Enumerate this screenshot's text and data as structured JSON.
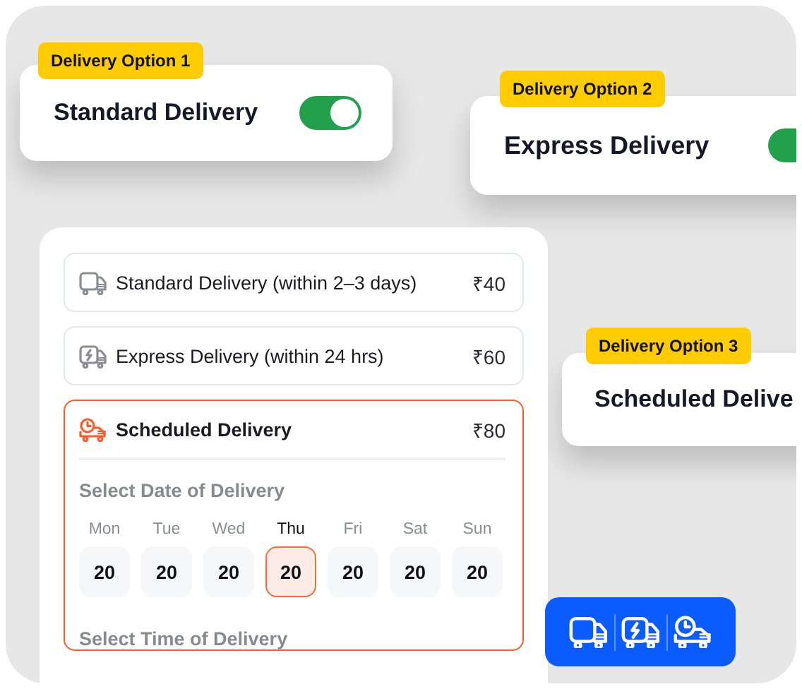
{
  "option_cards": [
    {
      "badge": "Delivery Option 1",
      "title": "Standard Delivery",
      "toggle_on": true
    },
    {
      "badge": "Delivery Option 2",
      "title": "Express Delivery",
      "toggle_on": true
    },
    {
      "badge": "Delivery Option 3",
      "title": "Scheduled Delive"
    }
  ],
  "delivery_panel": {
    "options": [
      {
        "kind": "standard",
        "label": "Standard Delivery (within 2–3 days)",
        "price": "₹40",
        "selected": false
      },
      {
        "kind": "express",
        "label": "Express Delivery (within 24 hrs)",
        "price": "₹60",
        "selected": false
      },
      {
        "kind": "scheduled",
        "label": "Scheduled Delivery",
        "price": "₹80",
        "selected": true
      }
    ],
    "date_heading": "Select Date of Delivery",
    "days": [
      {
        "day": "Mon",
        "date": "20",
        "selected": false
      },
      {
        "day": "Tue",
        "date": "20",
        "selected": false
      },
      {
        "day": "Wed",
        "date": "20",
        "selected": false
      },
      {
        "day": "Thu",
        "date": "20",
        "selected": true
      },
      {
        "day": "Fri",
        "date": "20",
        "selected": false
      },
      {
        "day": "Sat",
        "date": "20",
        "selected": false
      },
      {
        "day": "Sun",
        "date": "20",
        "selected": false
      }
    ],
    "time_heading": "Select Time of Delivery"
  },
  "icon_bar": {
    "icons": [
      {
        "kind": "standard"
      },
      {
        "kind": "express"
      },
      {
        "kind": "scheduled"
      }
    ]
  }
}
